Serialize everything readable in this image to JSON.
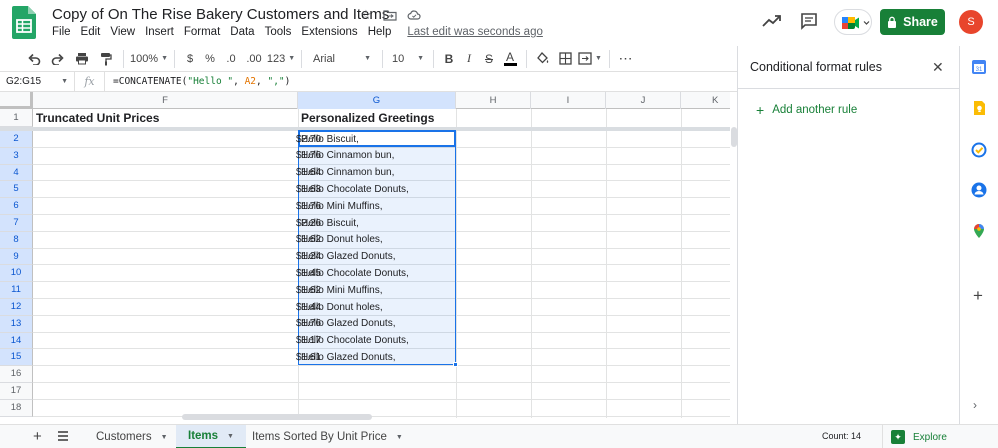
{
  "window": {
    "title": "Copy of On The Rise Bakery Customers and Items",
    "last_edit": "Last edit was seconds ago",
    "share_label": "Share",
    "avatar_initial": "S"
  },
  "menu": [
    "File",
    "Edit",
    "View",
    "Insert",
    "Format",
    "Data",
    "Tools",
    "Extensions",
    "Help"
  ],
  "toolbar": {
    "zoom": "100%",
    "currency": "$",
    "percent": "%",
    "decrease_decimal": ".0",
    "increase_decimal": ".00",
    "number_format": "123",
    "font": "Arial",
    "font_size": "10",
    "bold": "B",
    "italic": "I",
    "strikethrough": "S",
    "text_color": "A"
  },
  "formula_bar": {
    "name_box": "G2:G15",
    "fx": "fx",
    "formula_parts": [
      "=CONCATENATE(",
      "\"Hello \"",
      ", ",
      "A2",
      ", ",
      "\",\"",
      ")"
    ]
  },
  "grid": {
    "columns": [
      "F",
      "G",
      "H",
      "I",
      "J",
      "K"
    ],
    "selected_column": "G",
    "rows": [
      "1",
      "2",
      "3",
      "4",
      "5",
      "6",
      "7",
      "8",
      "9",
      "10",
      "11",
      "12",
      "13",
      "14",
      "15",
      "16",
      "17",
      "18"
    ],
    "header_row": {
      "F": "Truncated Unit Prices",
      "G": "Personalized Greetings"
    },
    "greetings": [
      "Hello Biscuit,",
      "Hello Cinnamon bun,",
      "Hello Cinnamon bun,",
      "Hello Chocolate Donuts,",
      "Hello Mini Muffins,",
      "Hello Biscuit,",
      "Hello Donut holes,",
      "Hello Glazed Donuts,",
      "Hello Chocolate Donuts,",
      "Hello Mini Muffins,",
      "Hello Donut holes,",
      "Hello Glazed Donuts,",
      "Hello Chocolate Donuts,",
      "Hello Glazed Donuts,"
    ],
    "overflow_prices": [
      "$2.70",
      "$1.76",
      "$1.64",
      "$1.63",
      "$1.76",
      "$2.26",
      "$1.62",
      "$1.24",
      "$1.45",
      "$1.62",
      "$1.44",
      "$1.76",
      "$1.17",
      "$1.61"
    ]
  },
  "sheets": {
    "tabs": [
      "Customers",
      "Items",
      "Items Sorted By Unit Price"
    ],
    "active": "Items",
    "count": "Count: 14",
    "explore": "Explore"
  },
  "side_panel": {
    "title": "Conditional format rules",
    "add_rule": "Add another rule"
  },
  "colors": {
    "accent_green": "#188038",
    "selection_blue": "#1a73e8",
    "avatar": "#e8452c"
  }
}
